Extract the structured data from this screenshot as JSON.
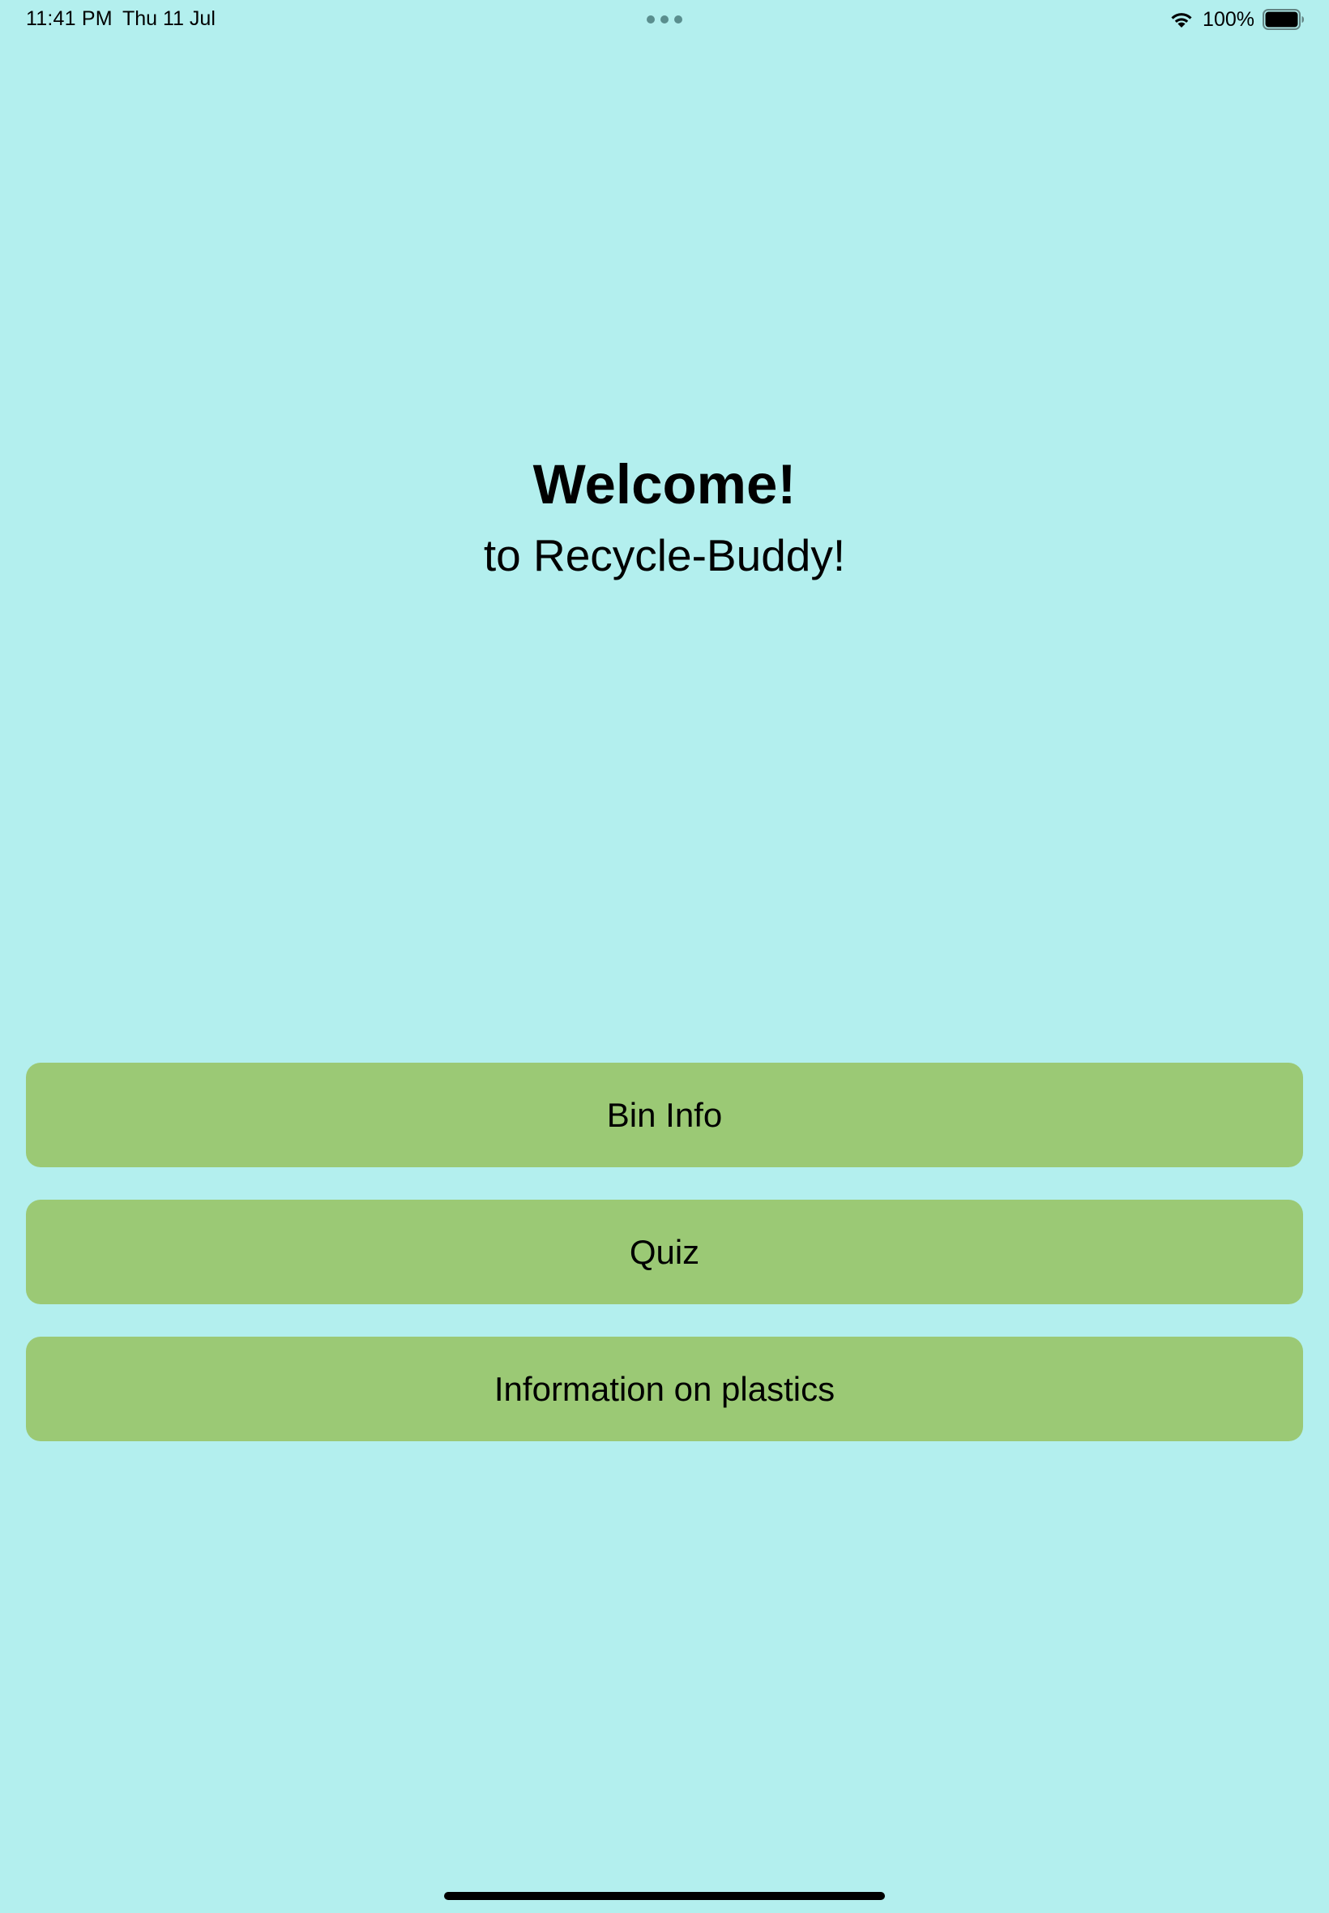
{
  "status_bar": {
    "time": "11:41 PM",
    "date": "Thu 11 Jul",
    "battery_percent": "100%",
    "battery_level": 1.0,
    "icons": [
      "wifi-icon",
      "battery-icon",
      "multitask-dots-icon"
    ]
  },
  "welcome": {
    "title": "Welcome!",
    "subtitle": "to Recycle-Buddy!"
  },
  "menu": {
    "items": [
      {
        "label": "Bin Info"
      },
      {
        "label": "Quiz"
      },
      {
        "label": "Information on plastics"
      }
    ]
  },
  "colors": {
    "background": "#b3efee",
    "button": "#9bc975",
    "text": "#000000"
  }
}
